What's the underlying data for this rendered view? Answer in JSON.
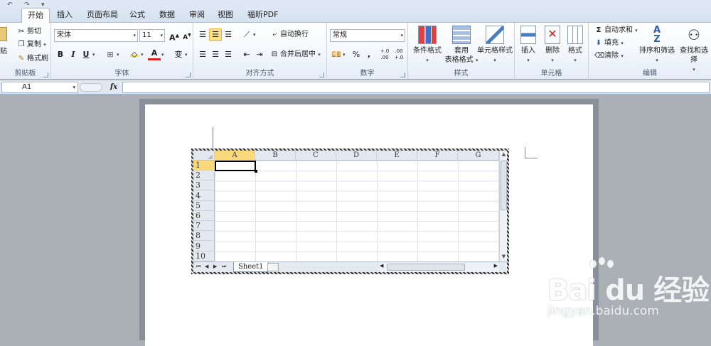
{
  "tabs": [
    {
      "label": "开始",
      "active": true
    },
    {
      "label": "插入"
    },
    {
      "label": "页面布局"
    },
    {
      "label": "公式"
    },
    {
      "label": "数据"
    },
    {
      "label": "审阅"
    },
    {
      "label": "视图"
    },
    {
      "label": "福昕PDF"
    }
  ],
  "clipboard": {
    "paste_label": "贴",
    "cut_label": "剪切",
    "copy_label": "复制",
    "format_painter_label": "格式刷",
    "group_label": "剪贴板"
  },
  "font": {
    "font_name": "宋体",
    "font_size": "11",
    "bold": "B",
    "italic": "I",
    "underline": "U",
    "grow": "A",
    "shrink": "A",
    "font_color_glyph": "A",
    "phonetic": "变",
    "group_label": "字体"
  },
  "alignment": {
    "wrap_label": "自动换行",
    "merge_label": "合并后居中",
    "group_label": "对齐方式"
  },
  "number": {
    "format": "常规",
    "percent": "%",
    "comma": ",",
    "inc_decimal": "+.0 .00",
    "dec_decimal": ".00 +.0",
    "group_label": "数字"
  },
  "styles": {
    "conditional_label": "条件格式",
    "table_label_line1": "套用",
    "table_label_line2": "表格格式",
    "cell_style_label": "单元格样式",
    "group_label": "样式"
  },
  "cells": {
    "insert_label": "插入",
    "delete_label": "删除",
    "format_label": "格式",
    "group_label": "单元格"
  },
  "editing": {
    "autosum_label": "自动求和",
    "fill_label": "填充",
    "clear_label": "清除",
    "sort_label": "排序和筛选",
    "find_label": "查找和选择",
    "group_label": "编辑"
  },
  "formula_bar": {
    "name_box": "A1",
    "fx": "fx",
    "value": ""
  },
  "sheet": {
    "columns": [
      "A",
      "B",
      "C",
      "D",
      "E",
      "F",
      "G"
    ],
    "rows": [
      "1",
      "2",
      "3",
      "4",
      "5",
      "6",
      "7",
      "8",
      "9",
      "10"
    ],
    "active_cell": "A1",
    "sheet_tab": "Sheet1"
  },
  "watermark": {
    "logo": "Bai du 经验",
    "url": "jingyan.baidu.com"
  },
  "colors": {
    "selection_header": "#f9d97a",
    "selected_button": "#fbe08a",
    "ribbon_border": "#a7bad3",
    "doc_background": "#abb0b6"
  }
}
